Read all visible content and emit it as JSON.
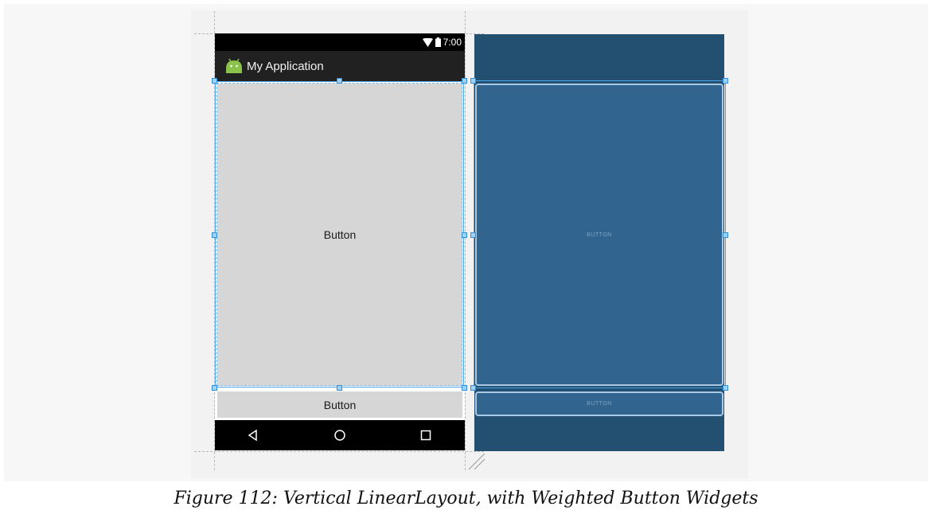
{
  "phone": {
    "status_bar": {
      "time": "7:00"
    },
    "app_bar": {
      "title": "My Application"
    },
    "buttons": [
      {
        "label": "Button",
        "weight_role": "weighted"
      },
      {
        "label": "Button",
        "weight_role": "wrap"
      }
    ],
    "nav_bar": {
      "icons": [
        "back-icon",
        "home-icon",
        "recents-icon"
      ]
    }
  },
  "blueprint": {
    "buttons": [
      {
        "label": "BUTTON"
      },
      {
        "label": "BUTTON"
      }
    ]
  },
  "caption": "Figure 112: Vertical LinearLayout, with Weighted Button Widgets",
  "colors": {
    "selection": "#4aa3e6",
    "blueprint_bg": "#234f70",
    "blueprint_button": "#31658f",
    "button_gray": "#d6d6d6",
    "app_bar": "#212121"
  }
}
